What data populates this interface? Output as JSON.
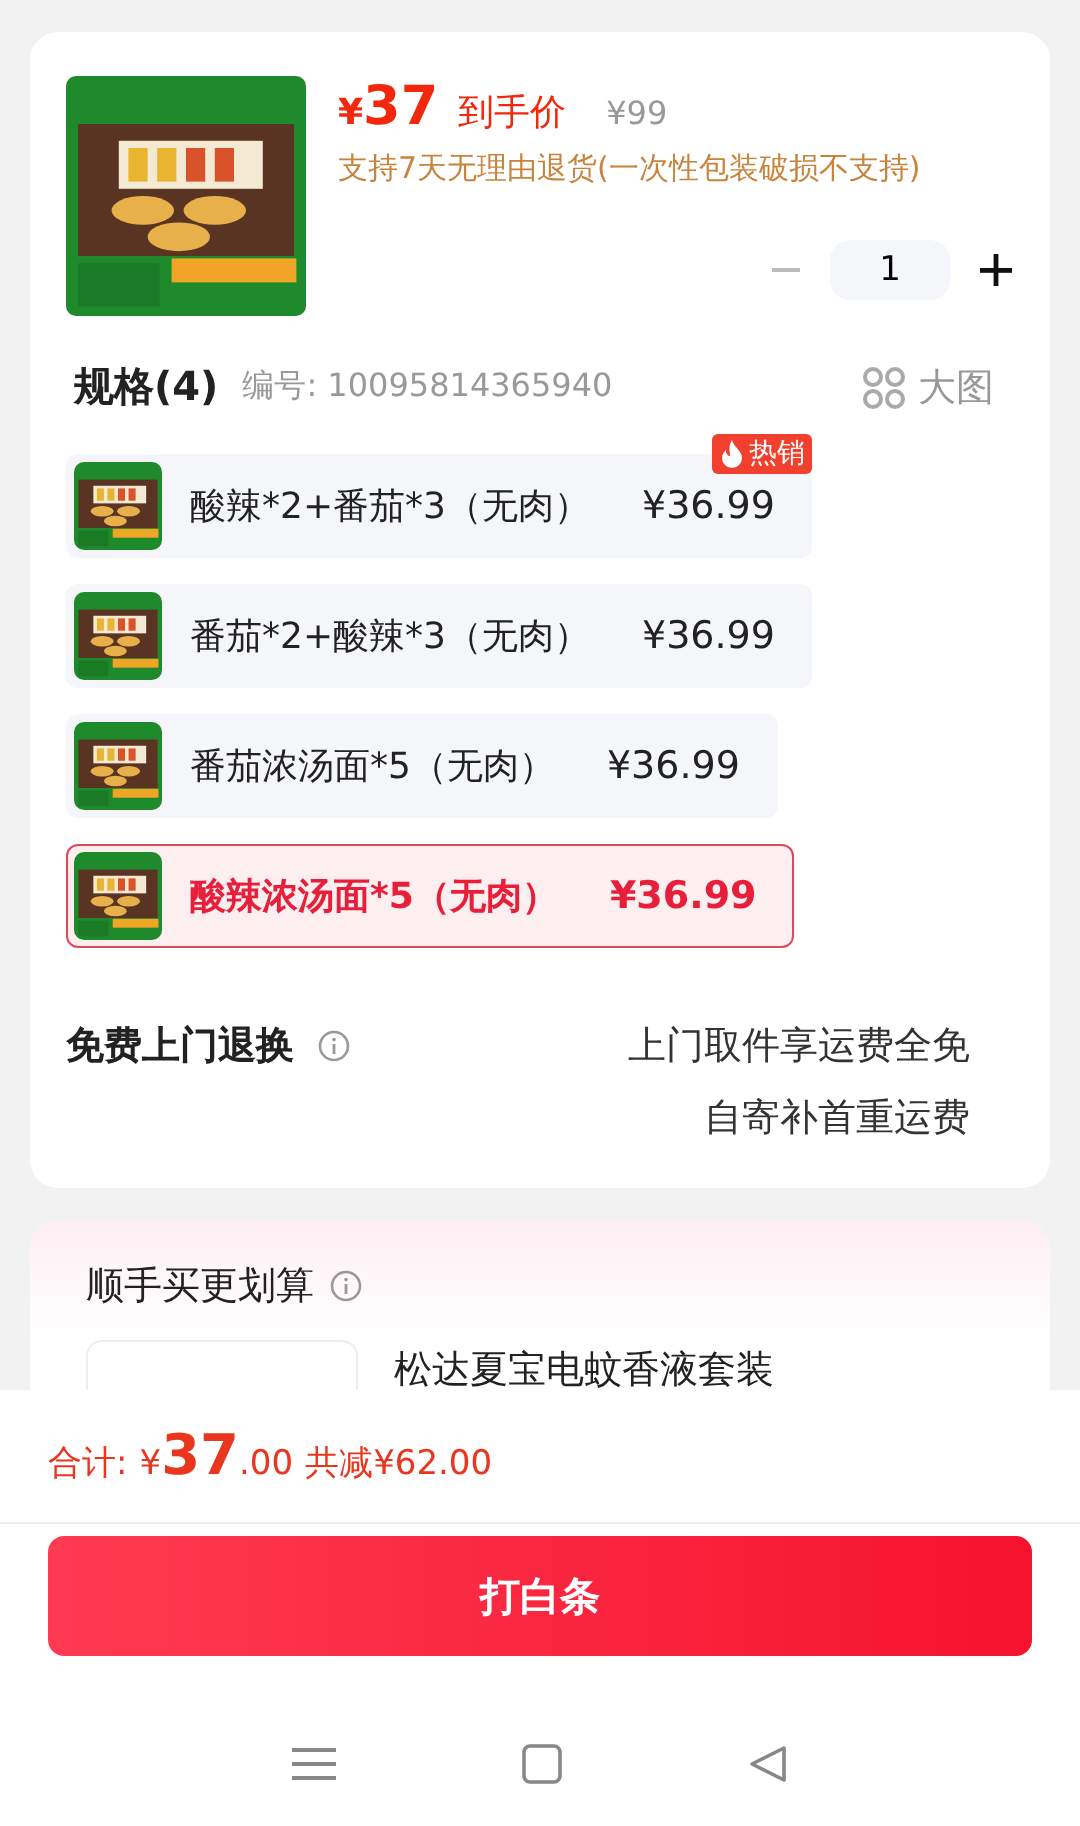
{
  "product": {
    "currency": "¥",
    "price": "37",
    "price_label": "到手价",
    "original_price": "¥99",
    "return_policy": "支持7天无理由退货(一次性包装破损不支持)",
    "quantity": "1"
  },
  "specs": {
    "title": "规格(4)",
    "code": "编号: 10095814365940",
    "view_toggle": "大图",
    "options": [
      {
        "name": "酸辣*2+番茄*3（无肉）",
        "price": "¥36.99",
        "badge": "热销",
        "selected": false
      },
      {
        "name": "番茄*2+酸辣*3（无肉）",
        "price": "¥36.99",
        "selected": false
      },
      {
        "name": "番茄浓汤面*5（无肉）",
        "price": "¥36.99",
        "selected": false
      },
      {
        "name": "酸辣浓汤面*5（无肉）",
        "price": "¥36.99",
        "selected": true
      }
    ]
  },
  "service": {
    "title": "免费上门退换",
    "lines": [
      "上门取件享运费全免",
      "自寄补首重运费"
    ]
  },
  "bundle": {
    "title": "顺手买更划算",
    "item_name": "松达夏宝电蚊香液套装"
  },
  "footer": {
    "total_label": "合计:",
    "currency": "¥",
    "total_int": "37",
    "total_dec": ".00",
    "discount": "共减¥62.00",
    "action": "打白条"
  }
}
